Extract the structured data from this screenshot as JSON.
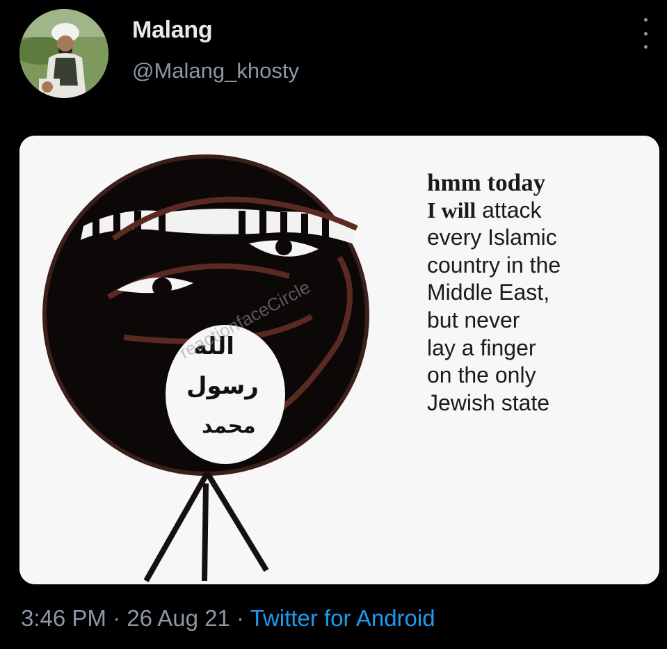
{
  "user": {
    "display_name": "Malang",
    "handle": "@Malang_khosty",
    "avatar_icon": "profile-photo"
  },
  "menu_icon": "more-vertical-icon",
  "meme": {
    "heading": "hmm today",
    "line_bold": "I will",
    "line_rest": " attack",
    "lines": [
      "every Islamic",
      "country in the",
      "Middle East,",
      "but never",
      "lay a finger",
      "on the only",
      "Jewish state"
    ],
    "flag_text_top": "الله",
    "flag_text_mid": "رسول",
    "flag_text_bottom": "محمد",
    "watermark": "reactionfaceCircle"
  },
  "meta": {
    "time": "3:46 PM",
    "separator": " · ",
    "date": "26 Aug 21",
    "client": "Twitter for Android"
  },
  "colors": {
    "background": "#000000",
    "name_text": "#e7e9ea",
    "secondary_text": "#8b98a5",
    "link": "#1d9bf0"
  }
}
